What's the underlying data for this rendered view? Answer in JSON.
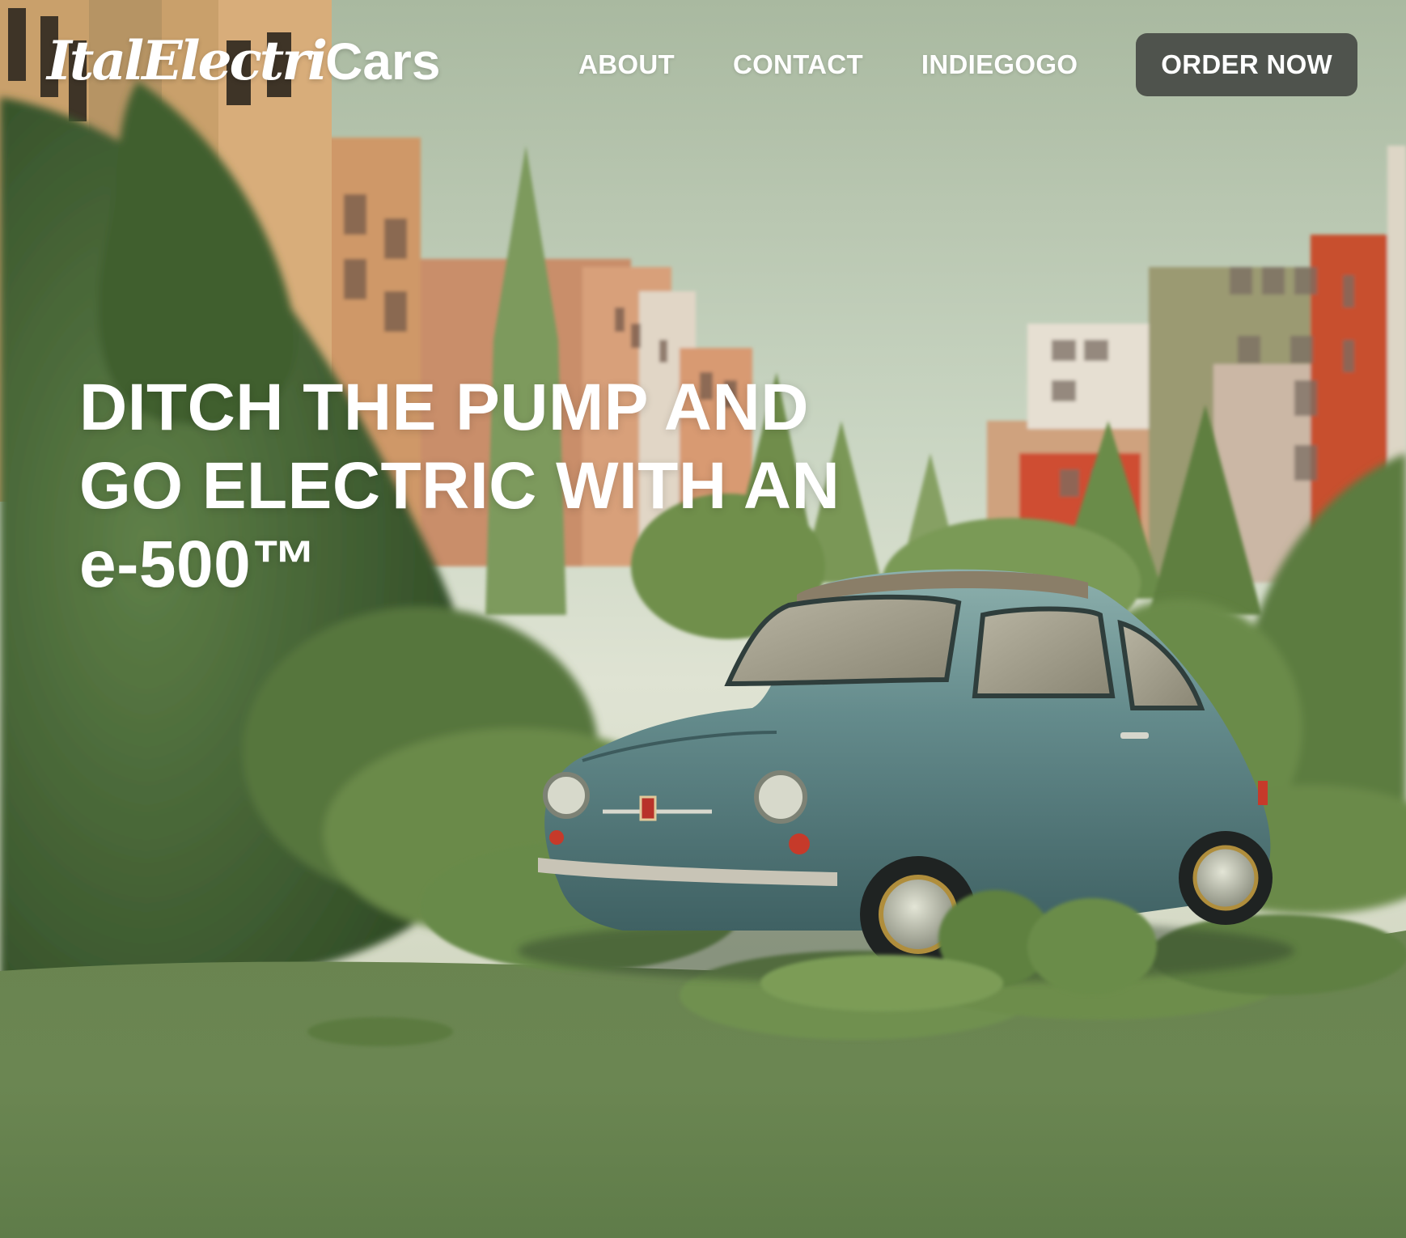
{
  "brand": {
    "logo_script": "ItalElectri",
    "logo_plain": "Cars"
  },
  "nav": {
    "links": [
      {
        "label": "ABOUT"
      },
      {
        "label": "CONTACT"
      },
      {
        "label": "INDIEGOGO"
      }
    ],
    "cta_label": "ORDER NOW"
  },
  "hero": {
    "headline_lines": [
      "DITCH THE PUMP AND",
      "GO ELECTRIC WITH AN",
      "e-500™"
    ]
  },
  "colors": {
    "cta_background": "#4f534d",
    "text": "#ffffff",
    "car_body": "#5f8587",
    "foliage": "#5e7e42"
  }
}
